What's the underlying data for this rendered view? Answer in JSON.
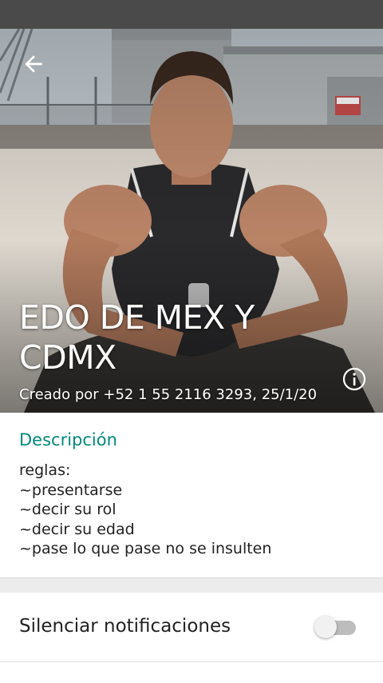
{
  "group": {
    "title": "EDO DE MEX Y CDMX",
    "created_by": "Creado por +52 1 55 2116 3293, 25/1/20"
  },
  "icons": {
    "back": "arrow-back-icon",
    "info": "info-icon"
  },
  "description": {
    "heading": "Descripción",
    "lines": [
      "reglas:",
      "~presentarse",
      "~decir su rol",
      "~decir su edad",
      "~pase lo que pase no se insulten"
    ]
  },
  "settings": {
    "mute_label": "Silenciar notificaciones",
    "mute_enabled": false
  },
  "colors": {
    "accent": "#00897b",
    "status_bar": "#4a4a4a",
    "toggle_off_track": "#bdbdbd"
  }
}
